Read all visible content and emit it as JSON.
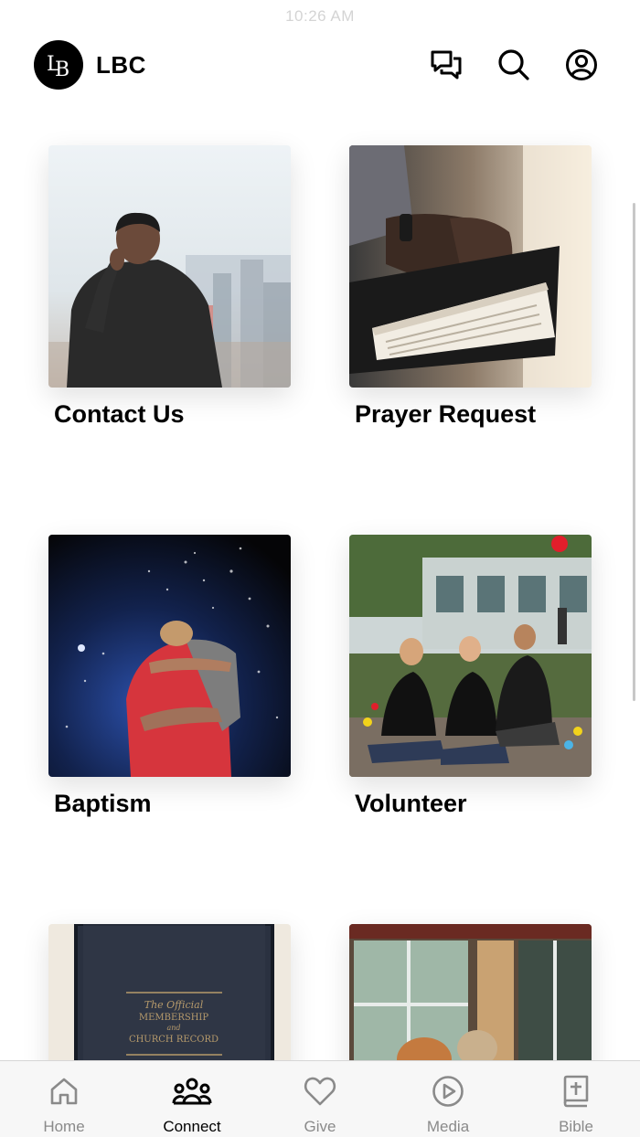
{
  "status_bar": {
    "time": "10:26 AM"
  },
  "header": {
    "logo_text": "LB",
    "brand_name": "LBC",
    "icons": [
      "chat-icon",
      "search-icon",
      "profile-icon"
    ]
  },
  "cards": [
    {
      "label": "Contact Us"
    },
    {
      "label": "Prayer Request"
    },
    {
      "label": "Baptism"
    },
    {
      "label": "Volunteer"
    },
    {
      "label": ""
    },
    {
      "label": ""
    }
  ],
  "book_cover": {
    "line1": "The Official",
    "line2": "MEMBERSHIP",
    "line3": "and",
    "line4": "CHURCH RECORD"
  },
  "tabs": [
    {
      "label": "Home",
      "icon": "home-icon",
      "active": false
    },
    {
      "label": "Connect",
      "icon": "people-icon",
      "active": true
    },
    {
      "label": "Give",
      "icon": "heart-icon",
      "active": false
    },
    {
      "label": "Media",
      "icon": "play-icon",
      "active": false
    },
    {
      "label": "Bible",
      "icon": "bible-icon",
      "active": false
    }
  ],
  "colors": {
    "active_tab": "#000000",
    "inactive_tab": "#8a8a8a",
    "tabbar_bg": "#f7f7f7"
  }
}
